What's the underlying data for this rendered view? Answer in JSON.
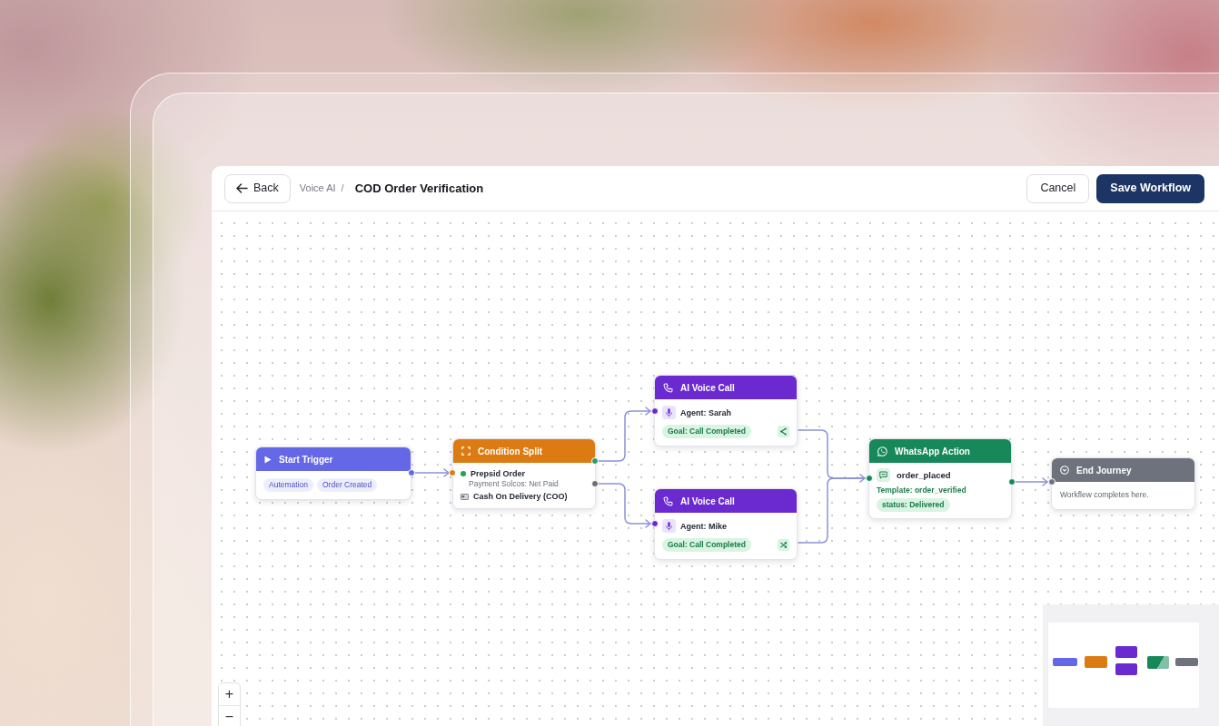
{
  "header": {
    "back": "Back",
    "breadcrumb": "Voice AI",
    "separator": "/",
    "title": "COD Order Verification",
    "buttons": [
      {
        "label": "Cancel",
        "kind": "secondary"
      },
      {
        "label": "Save Workflow",
        "kind": "primary"
      }
    ]
  },
  "nodes": [
    {
      "kind": "trigger",
      "title": "Start Trigger",
      "color": "#6467e6",
      "tags": [
        "Autemation",
        "Order Created"
      ]
    },
    {
      "kind": "condition",
      "title": "Condition Split",
      "color": "#db7b12",
      "branches": [
        {
          "kind": "dot",
          "label": "Prepsid Order",
          "detail": "Payment Solcos: Net Paid"
        },
        {
          "kind": "card",
          "label": "Cash On Delivery (COO)"
        }
      ]
    },
    {
      "kind": "voice",
      "title": "AI Voice Call",
      "color": "#6a2ad0",
      "agent": "Agent: Sarah",
      "goal": "Goal: Call Completed"
    },
    {
      "kind": "voice",
      "title": "AI Voice Call",
      "color": "#6a2ad0",
      "agent": "Agent: Mike",
      "goal": "Goal: Call Completed"
    },
    {
      "kind": "whatsapp",
      "title": "WhatsApp Action",
      "color": "#16885a",
      "event": "order_placed",
      "template": "Template: order_verified",
      "status": "status: Delivered"
    },
    {
      "kind": "end",
      "title": "End Journey",
      "color": "#6d727d",
      "note": "Workflew completes here."
    }
  ],
  "zoom_controls": [
    "+",
    "−"
  ]
}
